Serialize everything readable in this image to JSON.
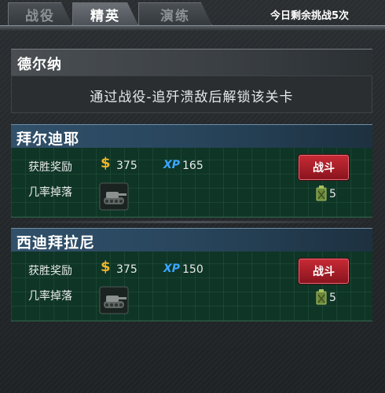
{
  "tabs": [
    {
      "label": "战役",
      "active": false
    },
    {
      "label": "精英",
      "active": true
    },
    {
      "label": "演练",
      "active": false
    }
  ],
  "remaining_label": "今日剩余挑战5次",
  "locked_stage": {
    "title": "德尔纳",
    "message": "通过战役-追歼溃敌后解锁该关卡"
  },
  "stages": [
    {
      "title": "拜尔迪耶",
      "reward_label": "获胜奖励",
      "coin_symbol": "$",
      "coins": "375",
      "xp_label": "XP",
      "xp": "165",
      "drop_label": "几率掉落",
      "fight_label": "战斗",
      "stamina": "5",
      "drop_icon": "tank-icon",
      "stamina_icon": "fuel-can-icon"
    },
    {
      "title": "西迪拜拉尼",
      "reward_label": "获胜奖励",
      "coin_symbol": "$",
      "coins": "375",
      "xp_label": "XP",
      "xp": "150",
      "drop_label": "几率掉落",
      "fight_label": "战斗",
      "stamina": "5",
      "drop_icon": "tank-icon",
      "stamina_icon": "fuel-can-icon"
    }
  ],
  "colors": {
    "accent_red": "#c62a35",
    "coin_gold": "#f0b62a",
    "xp_blue": "#3aa7ff",
    "card_green": "#0f3526"
  }
}
